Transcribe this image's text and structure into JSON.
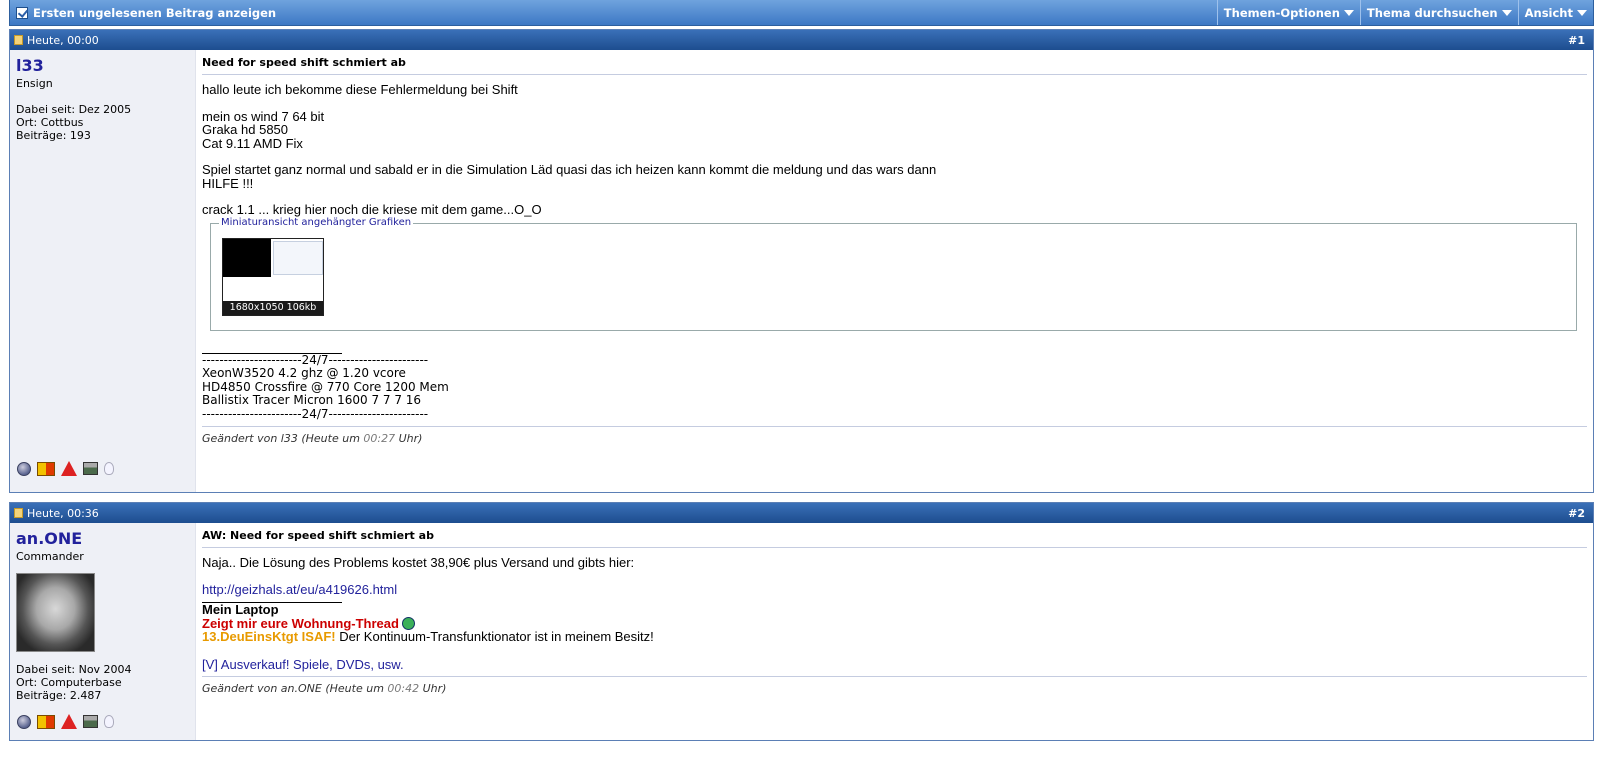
{
  "toolbar": {
    "first_unread": "Ersten ungelesenen Beitrag anzeigen",
    "thread_options": "Themen-Optionen",
    "search_thread": "Thema durchsuchen",
    "view": "Ansicht"
  },
  "posts": [
    {
      "date": "Heute, 00:00",
      "number": "#1",
      "username": "l33",
      "usertitle": "Ensign",
      "joined": "Dabei seit: Dez 2005",
      "location": "Ort: Cottbus",
      "posts": "Beiträge: 193",
      "title": "Need for speed shift schmiert ab",
      "paragraphs": [
        "hallo leute ich bekomme diese Fehlermeldung bei Shift",
        "mein os wind 7 64 bit",
        "Graka hd 5850",
        "Cat 9.11 AMD Fix",
        "Spiel startet ganz normal und sabald er in die Simulation Läd quasi das ich heizen kann kommt die meldung und das wars dann",
        "HILFE !!!",
        "crack 1.1 ... krieg hier noch die kriese mit dem game...O_O"
      ],
      "attachment_legend": "Miniaturansicht angehängter Grafiken",
      "attachment_caption": "1680x1050  106kb",
      "signature": [
        "-----------------------24/7-----------------------",
        "XeonW3520 4.2 ghz @ 1.20 vcore",
        "HD4850 Crossfire @ 770 Core 1200 Mem",
        "Ballistix Tracer Micron 1600 7 7 7 16",
        "-----------------------24/7-----------------------"
      ],
      "edited_prefix": "Geändert von l33 (Heute um ",
      "edited_time": "00:27",
      "edited_suffix": " Uhr)"
    },
    {
      "date": "Heute, 00:36",
      "number": "#2",
      "username": "an.ONE",
      "usertitle": "Commander",
      "joined": "Dabei seit: Nov 2004",
      "location": "Ort: Computerbase",
      "posts": "Beiträge: 2.487",
      "title": "AW: Need for speed shift schmiert ab",
      "text": "Naja.. Die Lösung des Problems kostet 38,90€ plus Versand und gibts hier:",
      "link": "http://geizhals.at/eu/a419626.html",
      "sig_laptop": "Mein Laptop",
      "sig_thread": "Zeigt mir eure Wohnung-Thread",
      "sig_isaf": "13.DeuEinsKtgt ISAF!",
      "sig_isaf_text": " Der Kontinuum-Transfunktionator ist in meinem Besitz!",
      "sig_sale": "[V] Ausverkauf! Spiele, DVDs, usw.",
      "edited_prefix": "Geändert von an.ONE (Heute um ",
      "edited_time": "00:42",
      "edited_suffix": " Uhr)"
    }
  ]
}
